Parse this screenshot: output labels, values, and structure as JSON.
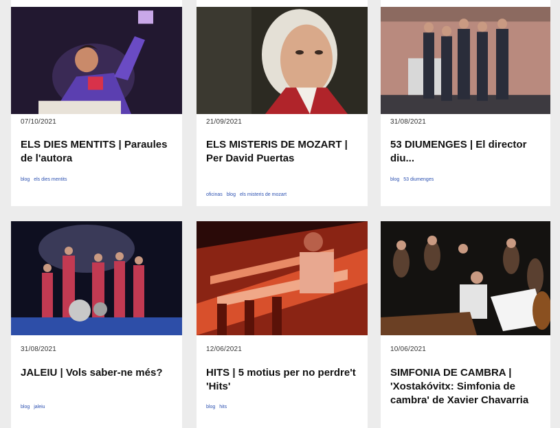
{
  "cards": [
    {
      "date": "07/10/2021",
      "title": "ELS DIES MENTITS | Paraules de l'autora",
      "tags": [
        "blog",
        "els dies mentits"
      ]
    },
    {
      "date": "21/09/2021",
      "title": "ELS MISTERIS DE MOZART | Per David Puertas",
      "tags": [
        "oficinas",
        "blog",
        "els misteris de mozart"
      ]
    },
    {
      "date": "31/08/2021",
      "title": "53 DIUMENGES | El director diu...",
      "tags": [
        "blog",
        "53 diumenges"
      ]
    },
    {
      "date": "31/08/2021",
      "title": "JALEIU | Vols saber-ne més?",
      "tags": [
        "blog",
        "jaleiu"
      ]
    },
    {
      "date": "12/06/2021",
      "title": "HITS | 5 motius per no perdre't 'Hits'",
      "tags": [
        "blog",
        "hits"
      ]
    },
    {
      "date": "10/06/2021",
      "title": "SIMFONIA DE CAMBRA | 'Xostakóvitx: Simfonia de cambra' de Xavier Chavarria",
      "tags": []
    }
  ],
  "colors": {
    "background": "#ececec",
    "card": "#ffffff",
    "tag": "#2a4fb0",
    "title": "#111111"
  },
  "icons": [
    "photo-actress",
    "photo-mozart-portrait",
    "photo-stage-cast",
    "photo-band",
    "photo-dancers",
    "photo-orchestra"
  ]
}
